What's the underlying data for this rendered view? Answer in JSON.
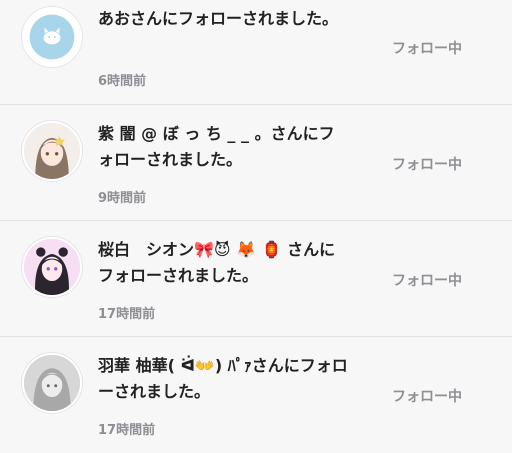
{
  "notifications": [
    {
      "message": "あおさんにフォローされました。",
      "time": "6時間前",
      "follow_status": "フォロー中",
      "avatar_icon": "cat-face-icon"
    },
    {
      "message": "紫 闇 @ ぼ っ ち _ _ 。さんにフォローされました。",
      "time": "9時間前",
      "follow_status": "フォロー中",
      "avatar_icon": "user-avatar"
    },
    {
      "message": "桜白　シオン🎀😈 🦊 🏮 さんにフォローされました。",
      "time": "17時間前",
      "follow_status": "フォロー中",
      "avatar_icon": "user-avatar"
    },
    {
      "message": "羽華 柚華( ᐛ👐) ﾊﾟｧさんにフォローされました。",
      "time": "17時間前",
      "follow_status": "フォロー中",
      "avatar_icon": "user-avatar"
    }
  ],
  "colors": {
    "background": "#f7f7f8",
    "text": "#222222",
    "muted": "#8e8e93",
    "divider": "#e1e1e4",
    "avatar_blue": "#a9d5ea"
  }
}
